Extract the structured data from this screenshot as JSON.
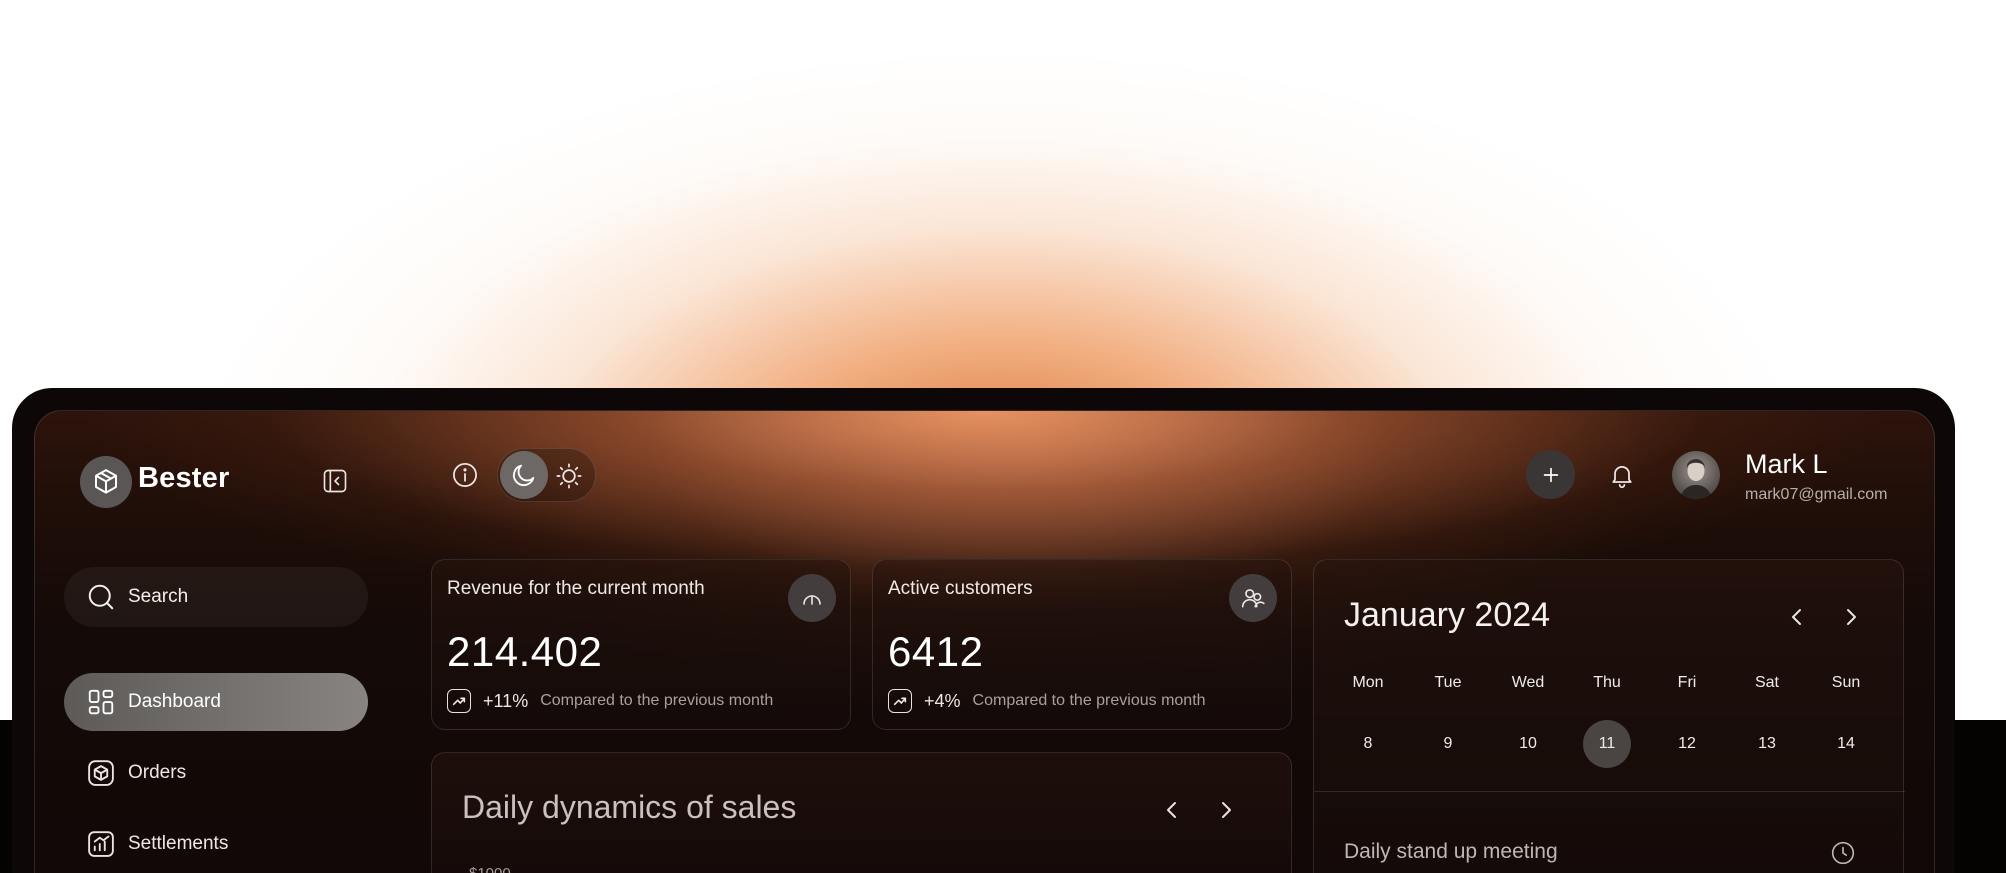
{
  "app": {
    "name": "Bester"
  },
  "sidebar": {
    "search_label": "Search",
    "items": [
      {
        "label": "Dashboard",
        "icon": "dashboard-icon",
        "active": true
      },
      {
        "label": "Orders",
        "icon": "box-icon",
        "active": false
      },
      {
        "label": "Settlements",
        "icon": "chart-icon",
        "active": false
      }
    ]
  },
  "header": {
    "theme": "dark",
    "user": {
      "name": "Mark L",
      "email": "mark07@gmail.com"
    }
  },
  "cards": [
    {
      "title": "Revenue for the current month",
      "value": "214.402",
      "change": "+11%",
      "note": "Compared to the previous month",
      "icon": "gauge-icon"
    },
    {
      "title": "Active customers",
      "value": "6412",
      "change": "+4%",
      "note": "Compared to the previous month",
      "icon": "users-icon"
    }
  ],
  "sales": {
    "title": "Daily dynamics of sales",
    "first_tick": "$1000"
  },
  "calendar": {
    "title": "January 2024",
    "weekdays": [
      "Mon",
      "Tue",
      "Wed",
      "Thu",
      "Fri",
      "Sat",
      "Sun"
    ],
    "dates": [
      "8",
      "9",
      "10",
      "11",
      "12",
      "13",
      "14"
    ],
    "selected": "11"
  },
  "meeting": {
    "title": "Daily stand up meeting"
  },
  "colors": {
    "accent_glow": "#d66e2d",
    "panel": "#110807",
    "active_nav": "#878482"
  }
}
